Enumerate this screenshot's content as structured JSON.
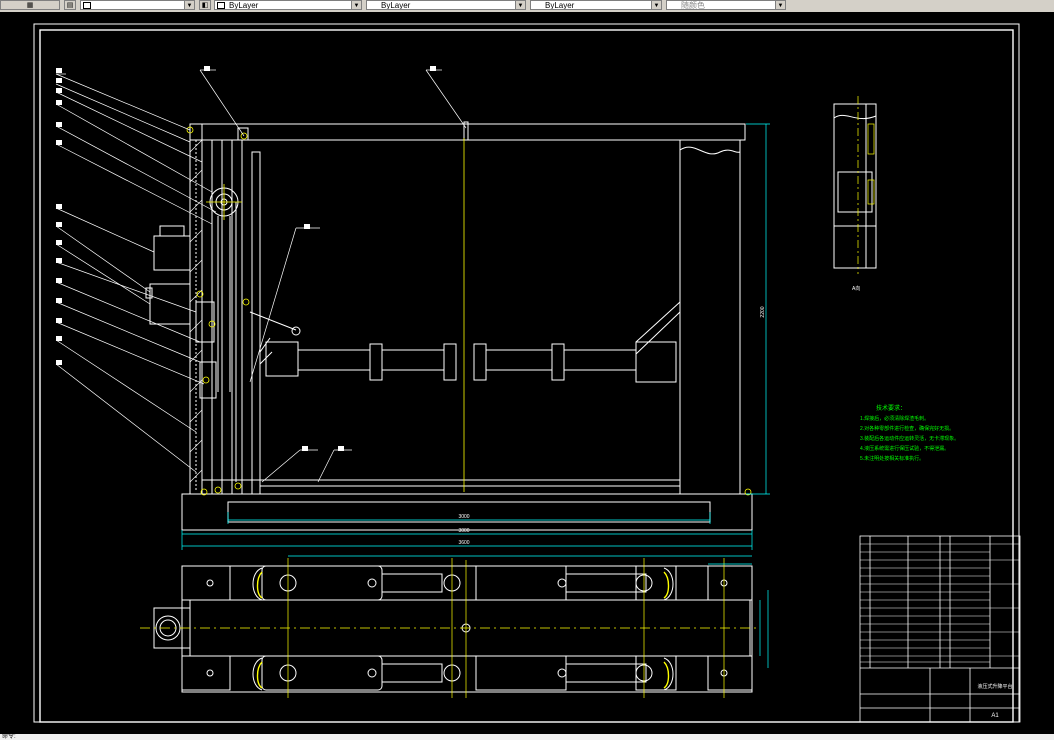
{
  "toolbar": {
    "linetype_label": "ByLayer",
    "lineweight_label": "ByLayer",
    "plotstyle_label": "ByLayer",
    "color_label": "随颜色"
  },
  "drawing": {
    "main_dimension": "3000",
    "overall_width_dimension": "3600",
    "height_dimension": "2200",
    "section_view_label": "A向",
    "title_block_name": "液压式升降平台",
    "title_block_code": "A1",
    "tech_req_title": "技术要求：",
    "tech_reqs": [
      "1.焊接后，必须清除焊渣毛刺。",
      "2.对各种零部件进行检查，确保完好无损。",
      "3.装配后各运动件应运转灵活，无卡滞现象。",
      "4.液压系统需进行保压试验，不得泄漏。",
      "5.未注明处按相关标准执行。"
    ]
  },
  "status": {
    "text": "命令:"
  },
  "colors": {
    "canvas": "#000000",
    "white_lines": "#ffffff",
    "dimension": "#00ffff",
    "centerline": "#ffff00",
    "notes": "#00ff00"
  }
}
